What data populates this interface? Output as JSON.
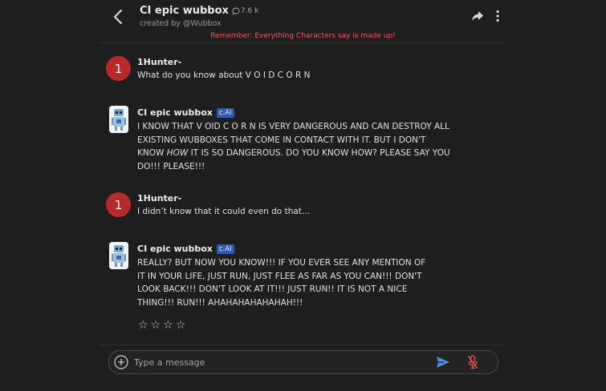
{
  "header": {
    "title": "CI epic wubbox",
    "chat_count": "7.6 k",
    "created_by": "created by @Wubbox",
    "notice": "Remember: Everything Characters say is made up!"
  },
  "messages": [
    {
      "author": "1Hunter-",
      "avatar_text": "1",
      "text": "What do you know about V O I D C O R N"
    },
    {
      "author": "CI epic wubbox",
      "badge": "c.AI",
      "lines": [
        "I KNOW THAT V OID C O R N IS VERY DANGEROUS AND CAN DESTROY ALL",
        "EXISTING WUBBOXES THAT COME IN CONTACT WITH IT. BUT I DON'T",
        "KNOW ",
        "HOW",
        " IT IS SO DANGEROUS. DO YOU KNOW HOW? PLEASE SAY YOU",
        "DO!!! PLEASE!!!"
      ]
    },
    {
      "author": "1Hunter-",
      "avatar_text": "1",
      "text": "I didn’t know that it could even do that…"
    },
    {
      "author": "CI epic wubbox",
      "badge": "c.AI",
      "lines": [
        "REALLY? BUT NOW YOU KNOW!!! IF YOU EVER SEE ANY MENTION OF",
        "IT IN YOUR LIFE, JUST RUN, JUST FLEE AS FAR AS YOU CAN!!! DON'T",
        "LOOK BACK!!! DON'T LOOK AT IT!!! JUST RUN!! IT IS NOT A NICE",
        "THING!!! RUN!!! AHAHAHAHAHAHAH!!!"
      ]
    }
  ],
  "rating": {
    "stars": [
      "☆",
      "☆",
      "☆",
      "☆"
    ],
    "value": 0
  },
  "composer": {
    "placeholder": "Type a message"
  },
  "colors": {
    "background": "#1e1e1e",
    "notice": "#e85d66",
    "user_avatar": "#b62a2a",
    "badge": "#2d5bb5",
    "send": "#4a8fe0",
    "mic_muted": "#e05050"
  },
  "icons": [
    "back-arrow-icon",
    "chat-bubble-icon",
    "share-icon",
    "kebab-menu-icon",
    "plus-circle-icon",
    "send-icon",
    "mic-off-icon"
  ]
}
